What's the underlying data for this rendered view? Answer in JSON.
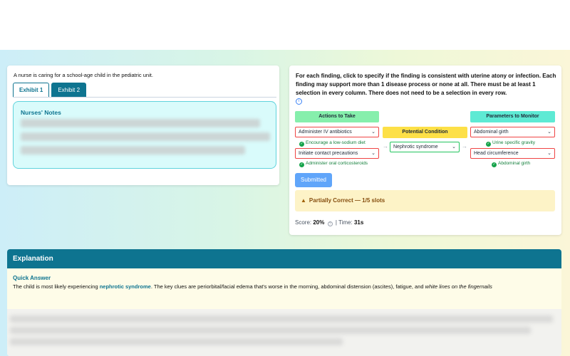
{
  "question": {
    "stem": "A nurse is caring for a school-age child in the pediatric unit.",
    "tabs": [
      {
        "label": "Exhibit 1",
        "active": true
      },
      {
        "label": "Exhibit 2",
        "active": false
      }
    ],
    "notes_title": "Nurses' Notes"
  },
  "task": {
    "instructions": "For each finding, click to specify if the finding is consistent with uterine atony or infection. Each finding may support more than 1 disease process or none at all. There must be at least 1 selection in every column. There does not need to be a selection in every row.",
    "columns": {
      "actions": "Actions to Take",
      "condition": "Potential Condition",
      "parameters": "Parameters to Monitor"
    },
    "selects": {
      "action_1": "Administer IV antibiotics",
      "action_2": "Initiate contact precautions",
      "condition_1": "Nephrotic syndrome",
      "param_1": "Abdominal girth",
      "param_2": "Head circumference"
    },
    "hints": {
      "action_1": "Encourage a low-sodium diet",
      "action_2": "Administer oral corticosteroids",
      "param_1": "Urine specific gravity",
      "param_2": "Abdominal girth"
    },
    "submit_label": "Submitted",
    "result_text": "Partially Correct — 1/5 slots",
    "score_label": "Score:",
    "score_value": "20%",
    "time_label": "Time:",
    "time_value": "31s",
    "colors": {
      "wrong": "#ef4444",
      "correct": "#22c55e",
      "accent": "#0e7490"
    }
  },
  "explanation": {
    "header": "Explanation",
    "quick_title": "Quick Answer",
    "text_before": "The child is most likely experiencing ",
    "highlight": "nephrotic syndrome",
    "text_after": ". The key clues are periorbital/facial edema that's worse in the morning, abdominal distension (ascites), fatigue, and ",
    "text_italic": "white lines on the fingernails"
  }
}
